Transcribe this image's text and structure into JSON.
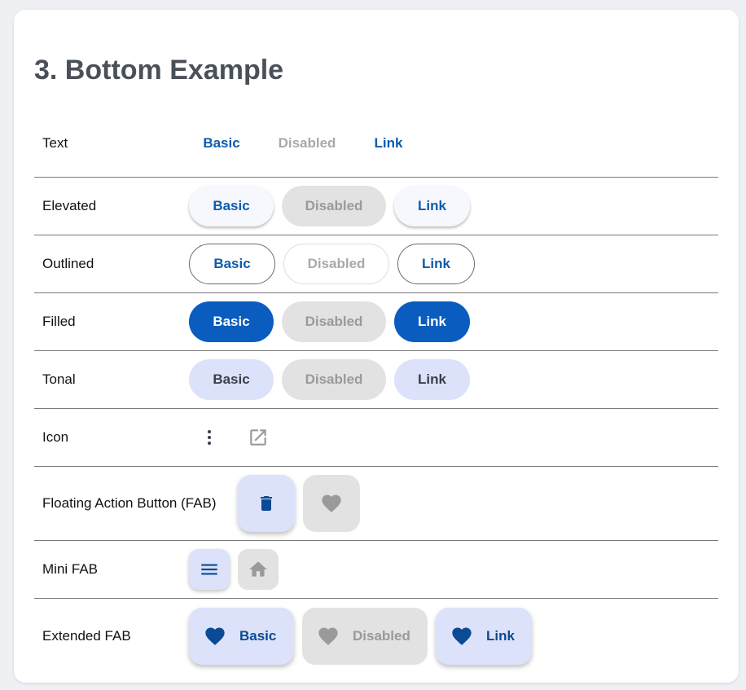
{
  "page": {
    "title": "3. Bottom Example"
  },
  "rows": {
    "text": {
      "label": "Text",
      "basic": "Basic",
      "disabled": "Disabled",
      "link": "Link"
    },
    "elevated": {
      "label": "Elevated",
      "basic": "Basic",
      "disabled": "Disabled",
      "link": "Link"
    },
    "outlined": {
      "label": "Outlined",
      "basic": "Basic",
      "disabled": "Disabled",
      "link": "Link"
    },
    "filled": {
      "label": "Filled",
      "basic": "Basic",
      "disabled": "Disabled",
      "link": "Link"
    },
    "tonal": {
      "label": "Tonal",
      "basic": "Basic",
      "disabled": "Disabled",
      "link": "Link"
    },
    "icon": {
      "label": "Icon",
      "icons": [
        "more-vert-icon",
        "open-in-new-icon"
      ]
    },
    "fab": {
      "label": "Floating Action Button (FAB)",
      "icons": [
        "delete-icon",
        "heart-icon"
      ]
    },
    "mini_fab": {
      "label": "Mini FAB",
      "icons": [
        "menu-icon",
        "home-icon"
      ]
    },
    "extended_fab": {
      "label": "Extended FAB",
      "basic": "Basic",
      "disabled": "Disabled",
      "link": "Link",
      "icon": "heart-icon"
    }
  },
  "colors": {
    "primary": "#0b5cbf",
    "tonal": "#dbe2f9",
    "disabled_bg": "#e2e2e2",
    "disabled_text": "#9a9a9a"
  }
}
